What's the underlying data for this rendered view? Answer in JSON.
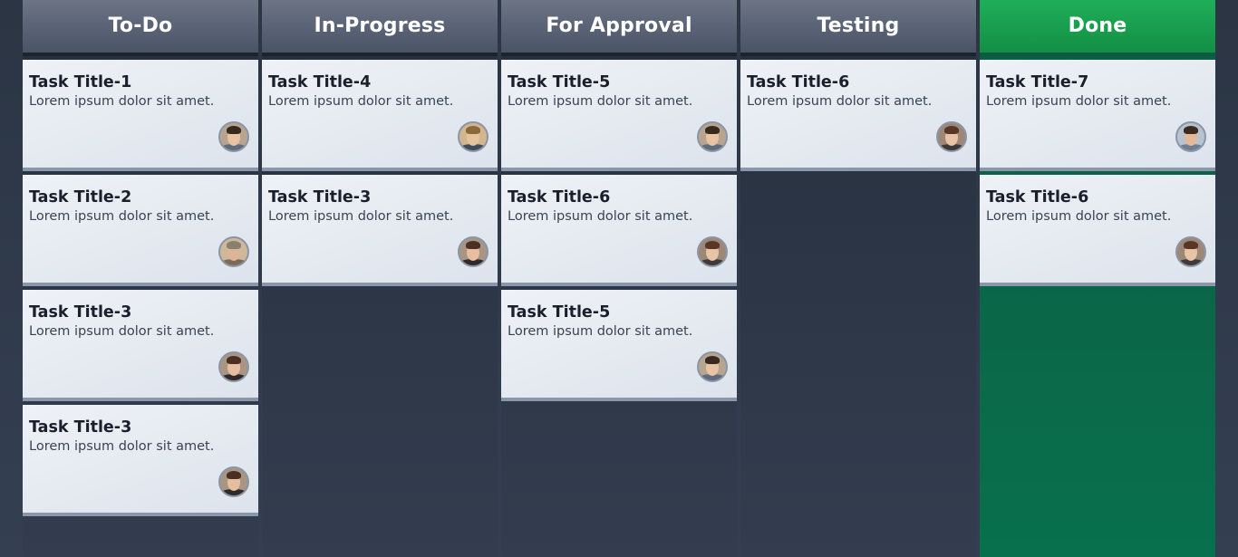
{
  "columns": [
    {
      "title": "To-Do",
      "cards": [
        {
          "title": "Task Title-1",
          "desc": "Lorem ipsum dolor sit amet.",
          "avatar": "person-a-avatar"
        },
        {
          "title": "Task Title-2",
          "desc": "Lorem ipsum dolor sit amet.",
          "avatar": "person-b-avatar"
        },
        {
          "title": "Task Title-3",
          "desc": "Lorem ipsum dolor sit amet.",
          "avatar": "person-c-avatar"
        },
        {
          "title": "Task Title-3",
          "desc": "Lorem ipsum dolor sit amet.",
          "avatar": "person-c-avatar"
        }
      ]
    },
    {
      "title": "In-Progress",
      "cards": [
        {
          "title": "Task Title-4",
          "desc": "Lorem ipsum dolor sit amet.",
          "avatar": "person-d-avatar"
        },
        {
          "title": "Task Title-3",
          "desc": "Lorem ipsum dolor sit amet.",
          "avatar": "person-c-avatar"
        }
      ]
    },
    {
      "title": "For Approval",
      "cards": [
        {
          "title": "Task Title-5",
          "desc": "Lorem ipsum dolor sit amet.",
          "avatar": "person-a-avatar"
        },
        {
          "title": "Task Title-6",
          "desc": "Lorem ipsum dolor sit amet.",
          "avatar": "person-e-avatar"
        },
        {
          "title": "Task Title-5",
          "desc": "Lorem ipsum dolor sit amet.",
          "avatar": "person-a-avatar"
        }
      ]
    },
    {
      "title": "Testing",
      "cards": [
        {
          "title": "Task Title-6",
          "desc": "Lorem ipsum dolor sit amet.",
          "avatar": "person-e-avatar"
        }
      ]
    },
    {
      "title": "Done",
      "cards": [
        {
          "title": "Task Title-7",
          "desc": "Lorem ipsum dolor sit amet.",
          "avatar": "person-f-avatar"
        },
        {
          "title": "Task Title-6",
          "desc": "Lorem ipsum dolor sit amet.",
          "avatar": "person-e-avatar"
        }
      ]
    }
  ],
  "colors": {
    "board_bg": "#2f3a4b",
    "header_bg": "#5a6374",
    "done_header": "#1a9e50",
    "done_column": "#08704c",
    "card_bg": "#e6ebf2",
    "card_border": "#8a97aa"
  }
}
